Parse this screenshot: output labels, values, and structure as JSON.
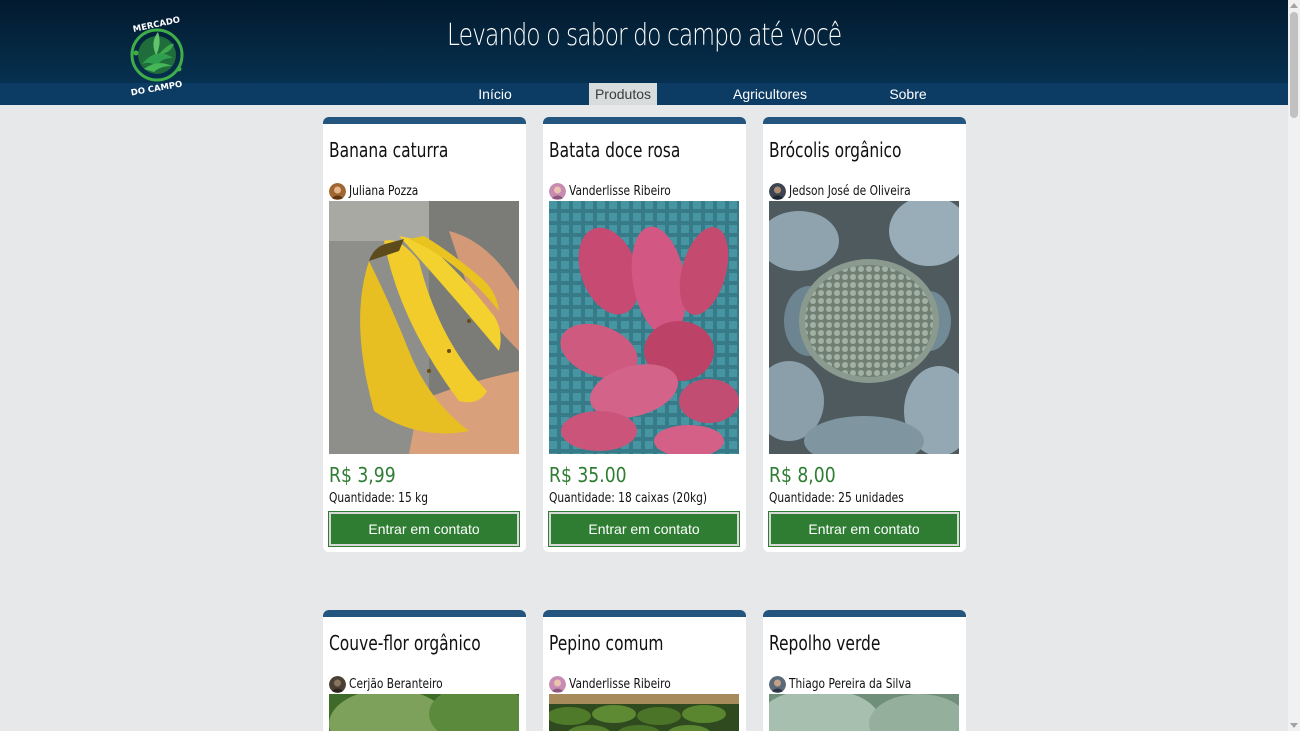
{
  "header": {
    "slogan": "Levando o sabor do campo até você",
    "logo": {
      "top_text": "MERCADO",
      "bottom_text": "DO CAMPO",
      "icon": "leaf-logo-icon"
    }
  },
  "nav": {
    "items": [
      {
        "label": "Início",
        "active": false
      },
      {
        "label": "Produtos",
        "active": true
      },
      {
        "label": "Agricultores",
        "active": false
      },
      {
        "label": "Sobre",
        "active": false
      }
    ]
  },
  "products": [
    {
      "title": "Banana caturra",
      "farmer": "Juliana Pozza",
      "price": "R$ 3,99",
      "quantity": "Quantidade: 15 kg",
      "button": "Entrar em contato"
    },
    {
      "title": "Batata doce rosa",
      "farmer": "Vanderlisse Ribeiro",
      "price": "R$ 35.00",
      "quantity": "Quantidade: 18 caixas (20kg)",
      "button": "Entrar em contato"
    },
    {
      "title": "Brócolis orgânico",
      "farmer": "Jedson José de Oliveira",
      "price": "R$ 8,00",
      "quantity": "Quantidade: 25 unidades",
      "button": "Entrar em contato"
    },
    {
      "title": "Couve-flor orgânico",
      "farmer": "Cerjão Beranteiro"
    },
    {
      "title": "Pepino comum",
      "farmer": "Vanderlisse Ribeiro"
    },
    {
      "title": "Repolho verde",
      "farmer": "Thiago Pereira da Silva"
    }
  ],
  "colors": {
    "header": "#06304f",
    "accent_border": "#24557f",
    "price": "#2e7d32",
    "button": "#2e7d32",
    "background": "#e6e8e9"
  }
}
